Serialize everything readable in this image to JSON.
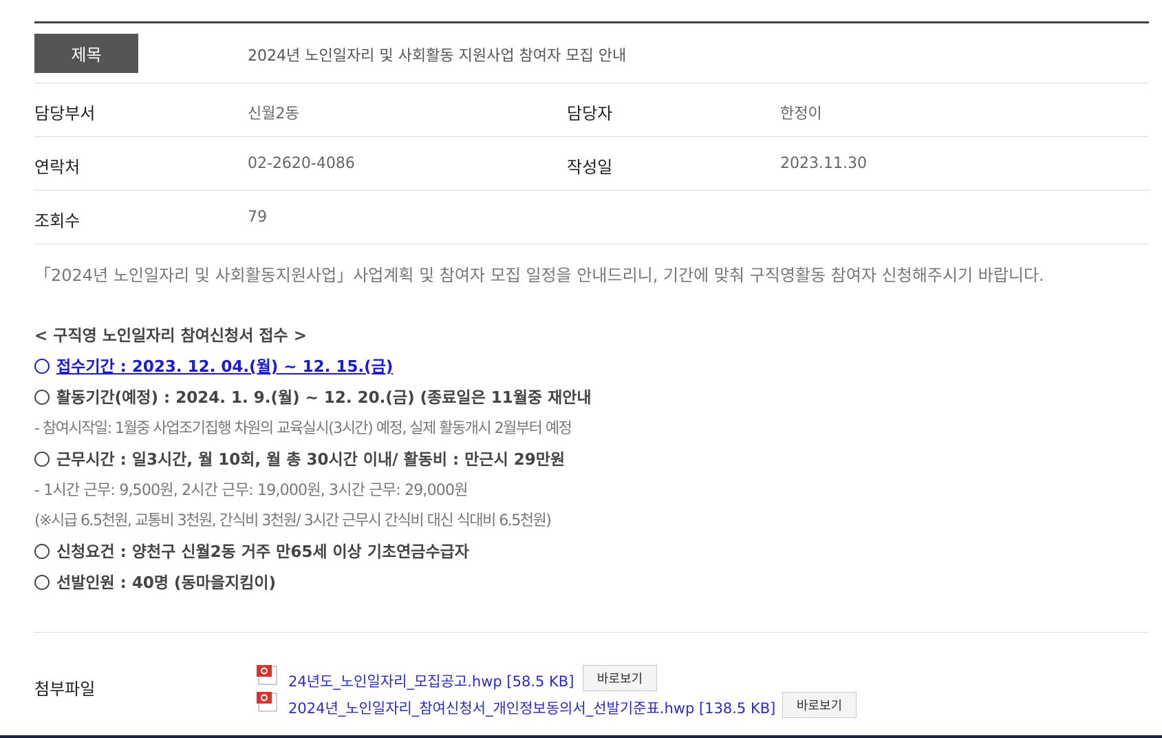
{
  "header": {
    "title_label": "제목",
    "title_value": "2024년 노인일자리 및 사회활동 지원사업 참여자 모집 안내"
  },
  "meta": {
    "dept_label": "담당부서",
    "dept_value": "신월2동",
    "person_label": "담당자",
    "person_value": "한정이",
    "contact_label": "연락처",
    "contact_value": "02-2620-4086",
    "date_label": "작성일",
    "date_value": "2023.11.30",
    "views_label": "조회수",
    "views_value": "79"
  },
  "body": {
    "intro": "「2024년 노인일자리 및 사회활동지원사업」사업계획 및 참여자 모집 일정을 안내드리니, 기간에 맞춰 구직영활동 참여자 신청해주시기 바랍니다.",
    "section_title": "< 구직영 노인일자리 참여신청서 접수 >",
    "reception": "접수기간 : 2023. 12. 04.(월) ~ 12. 15.(금)",
    "activity": "활동기간(예정) : 2024. 1. 9.(월) ~ 12. 20.(금) (종료일은 11월중 재안내",
    "activity_note": "- 참여시작일: 1월중 사업조기집행 차원의 교육실시(3시간) 예정, 실제 활동개시 2월부터 예정",
    "worktime": "근무시간 : 일3시간, 월 10회, 월 총 30시간 이내/ 활동비 : 만근시 29만원",
    "pay_note": "- 1시간 근무: 9,500원, 2시간 근무: 19,000원, 3시간 근무: 29,000원",
    "pay_detail": "(※시급 6.5천원, 교통비 3천원, 간식비 3천원/ 3시간 근무시 간식비 대신 식대비 6.5천원)",
    "requirement": "신청요건 : 양천구 신월2동 거주 만65세 이상 기초연금수급자",
    "selection": "선발인원 : 40명 (동마을지킴이)"
  },
  "attachments": {
    "label": "첨부파일",
    "files": [
      {
        "name": "24년도_노인일자리_모집공고.hwp [58.5 KB]",
        "view_label": "바로보기",
        "icon": "hwp-file-icon"
      },
      {
        "name": "2024년_노인일자리_참여신청서_개인정보동의서_선발기준표.hwp [138.5 KB]",
        "view_label": "바로보기",
        "icon": "hwp-file-icon"
      }
    ]
  },
  "colors": {
    "link": "#1a1ad8",
    "badge_bg": "#555555",
    "bottom_bar": "#1c2340"
  }
}
